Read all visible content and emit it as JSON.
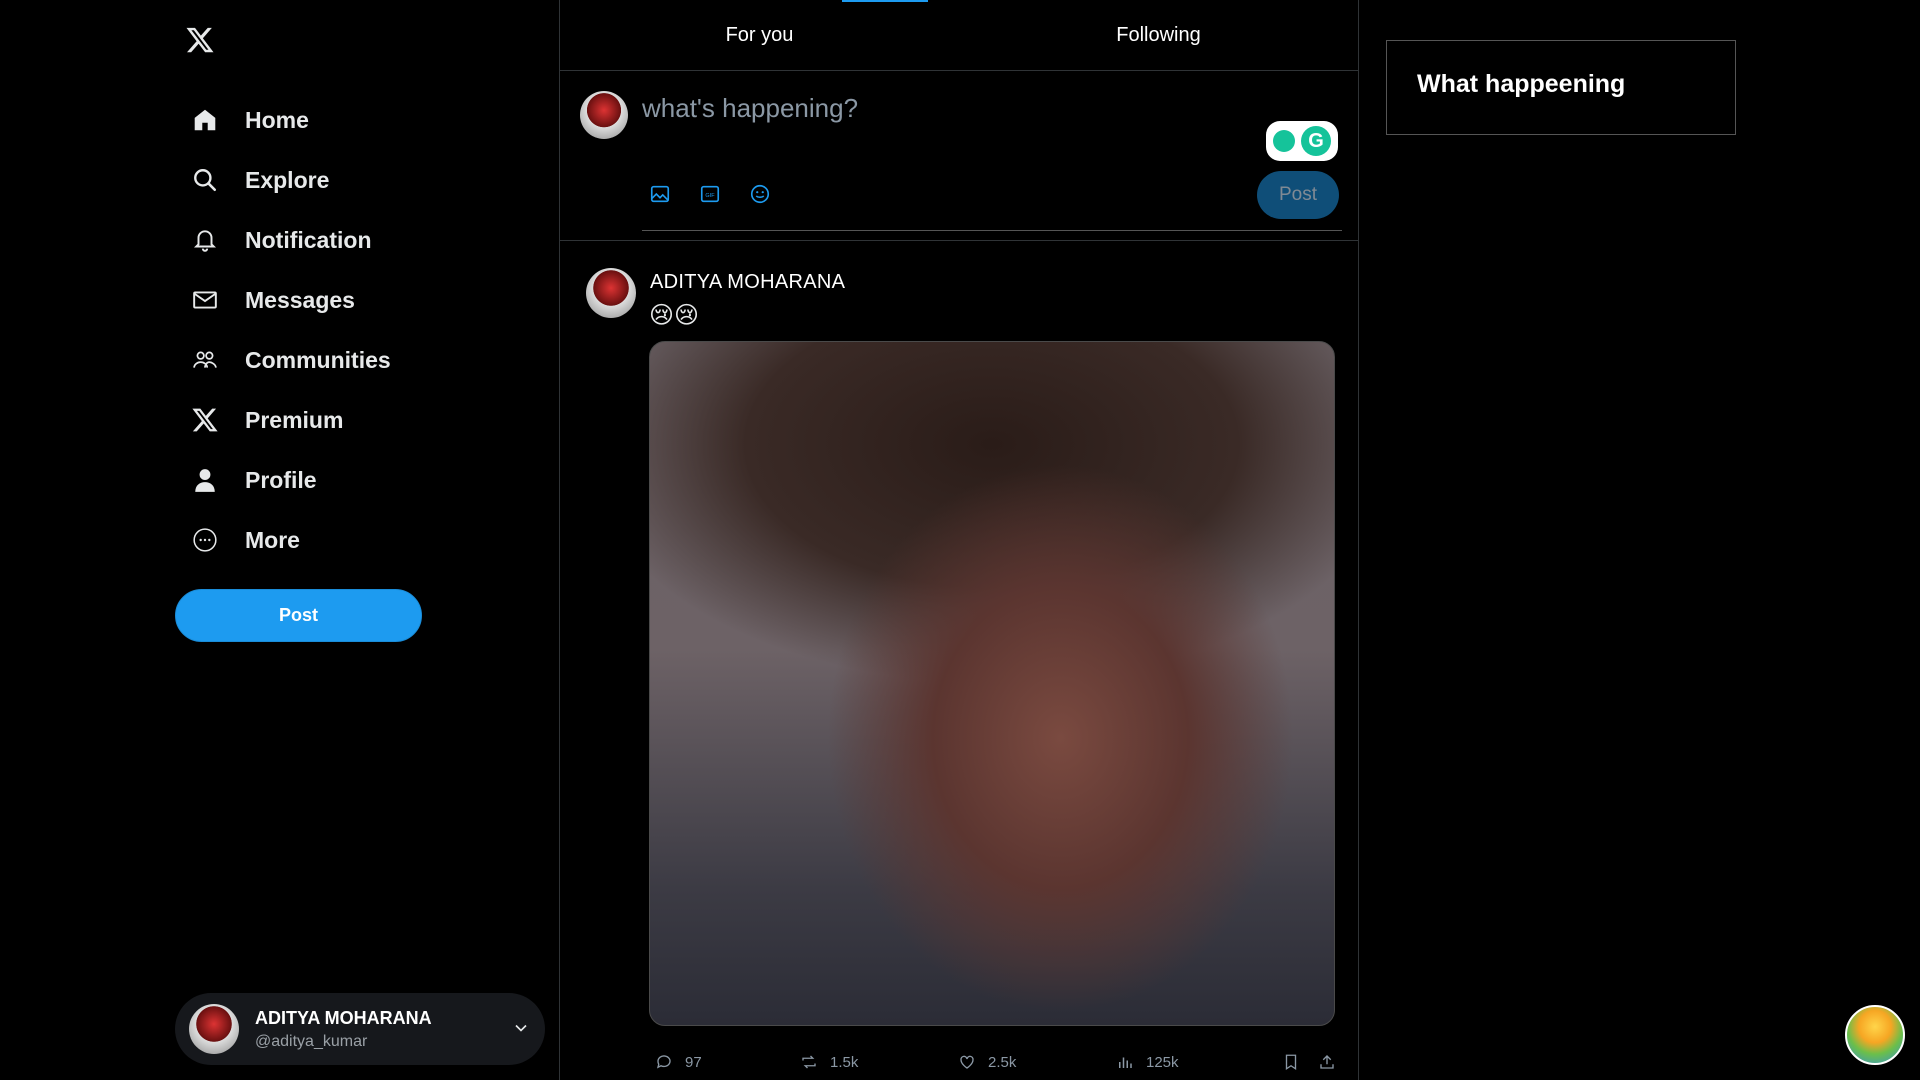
{
  "sidebar": {
    "logo": "x-logo",
    "items": [
      {
        "label": "Home",
        "icon": "home-icon"
      },
      {
        "label": "Explore",
        "icon": "search-icon"
      },
      {
        "label": "Notification",
        "icon": "bell-icon"
      },
      {
        "label": "Messages",
        "icon": "mail-icon"
      },
      {
        "label": "Communities",
        "icon": "people-icon"
      },
      {
        "label": "Premium",
        "icon": "x-logo-icon"
      },
      {
        "label": "Profile",
        "icon": "person-icon"
      },
      {
        "label": "More",
        "icon": "more-circle-icon"
      }
    ],
    "post_label": "Post",
    "account": {
      "name": "ADITYA MOHARANA",
      "handle": "@aditya_kumar"
    }
  },
  "tabs": [
    {
      "label": "For you",
      "active": true
    },
    {
      "label": "Following",
      "active": false
    }
  ],
  "composer": {
    "placeholder": "what's happening?",
    "post_label": "Post",
    "tools": [
      "image-icon",
      "gif-icon",
      "emoji-icon"
    ]
  },
  "tweet": {
    "author": "ADITYA MOHARANA",
    "text": "😢😢",
    "stats": {
      "replies": "97",
      "reposts": "1.5k",
      "likes": "2.5k",
      "views": "125k"
    }
  },
  "right": {
    "title": "What happeening"
  },
  "colors": {
    "accent": "#1d9bf0",
    "background": "#000000",
    "border": "#2f3336"
  }
}
